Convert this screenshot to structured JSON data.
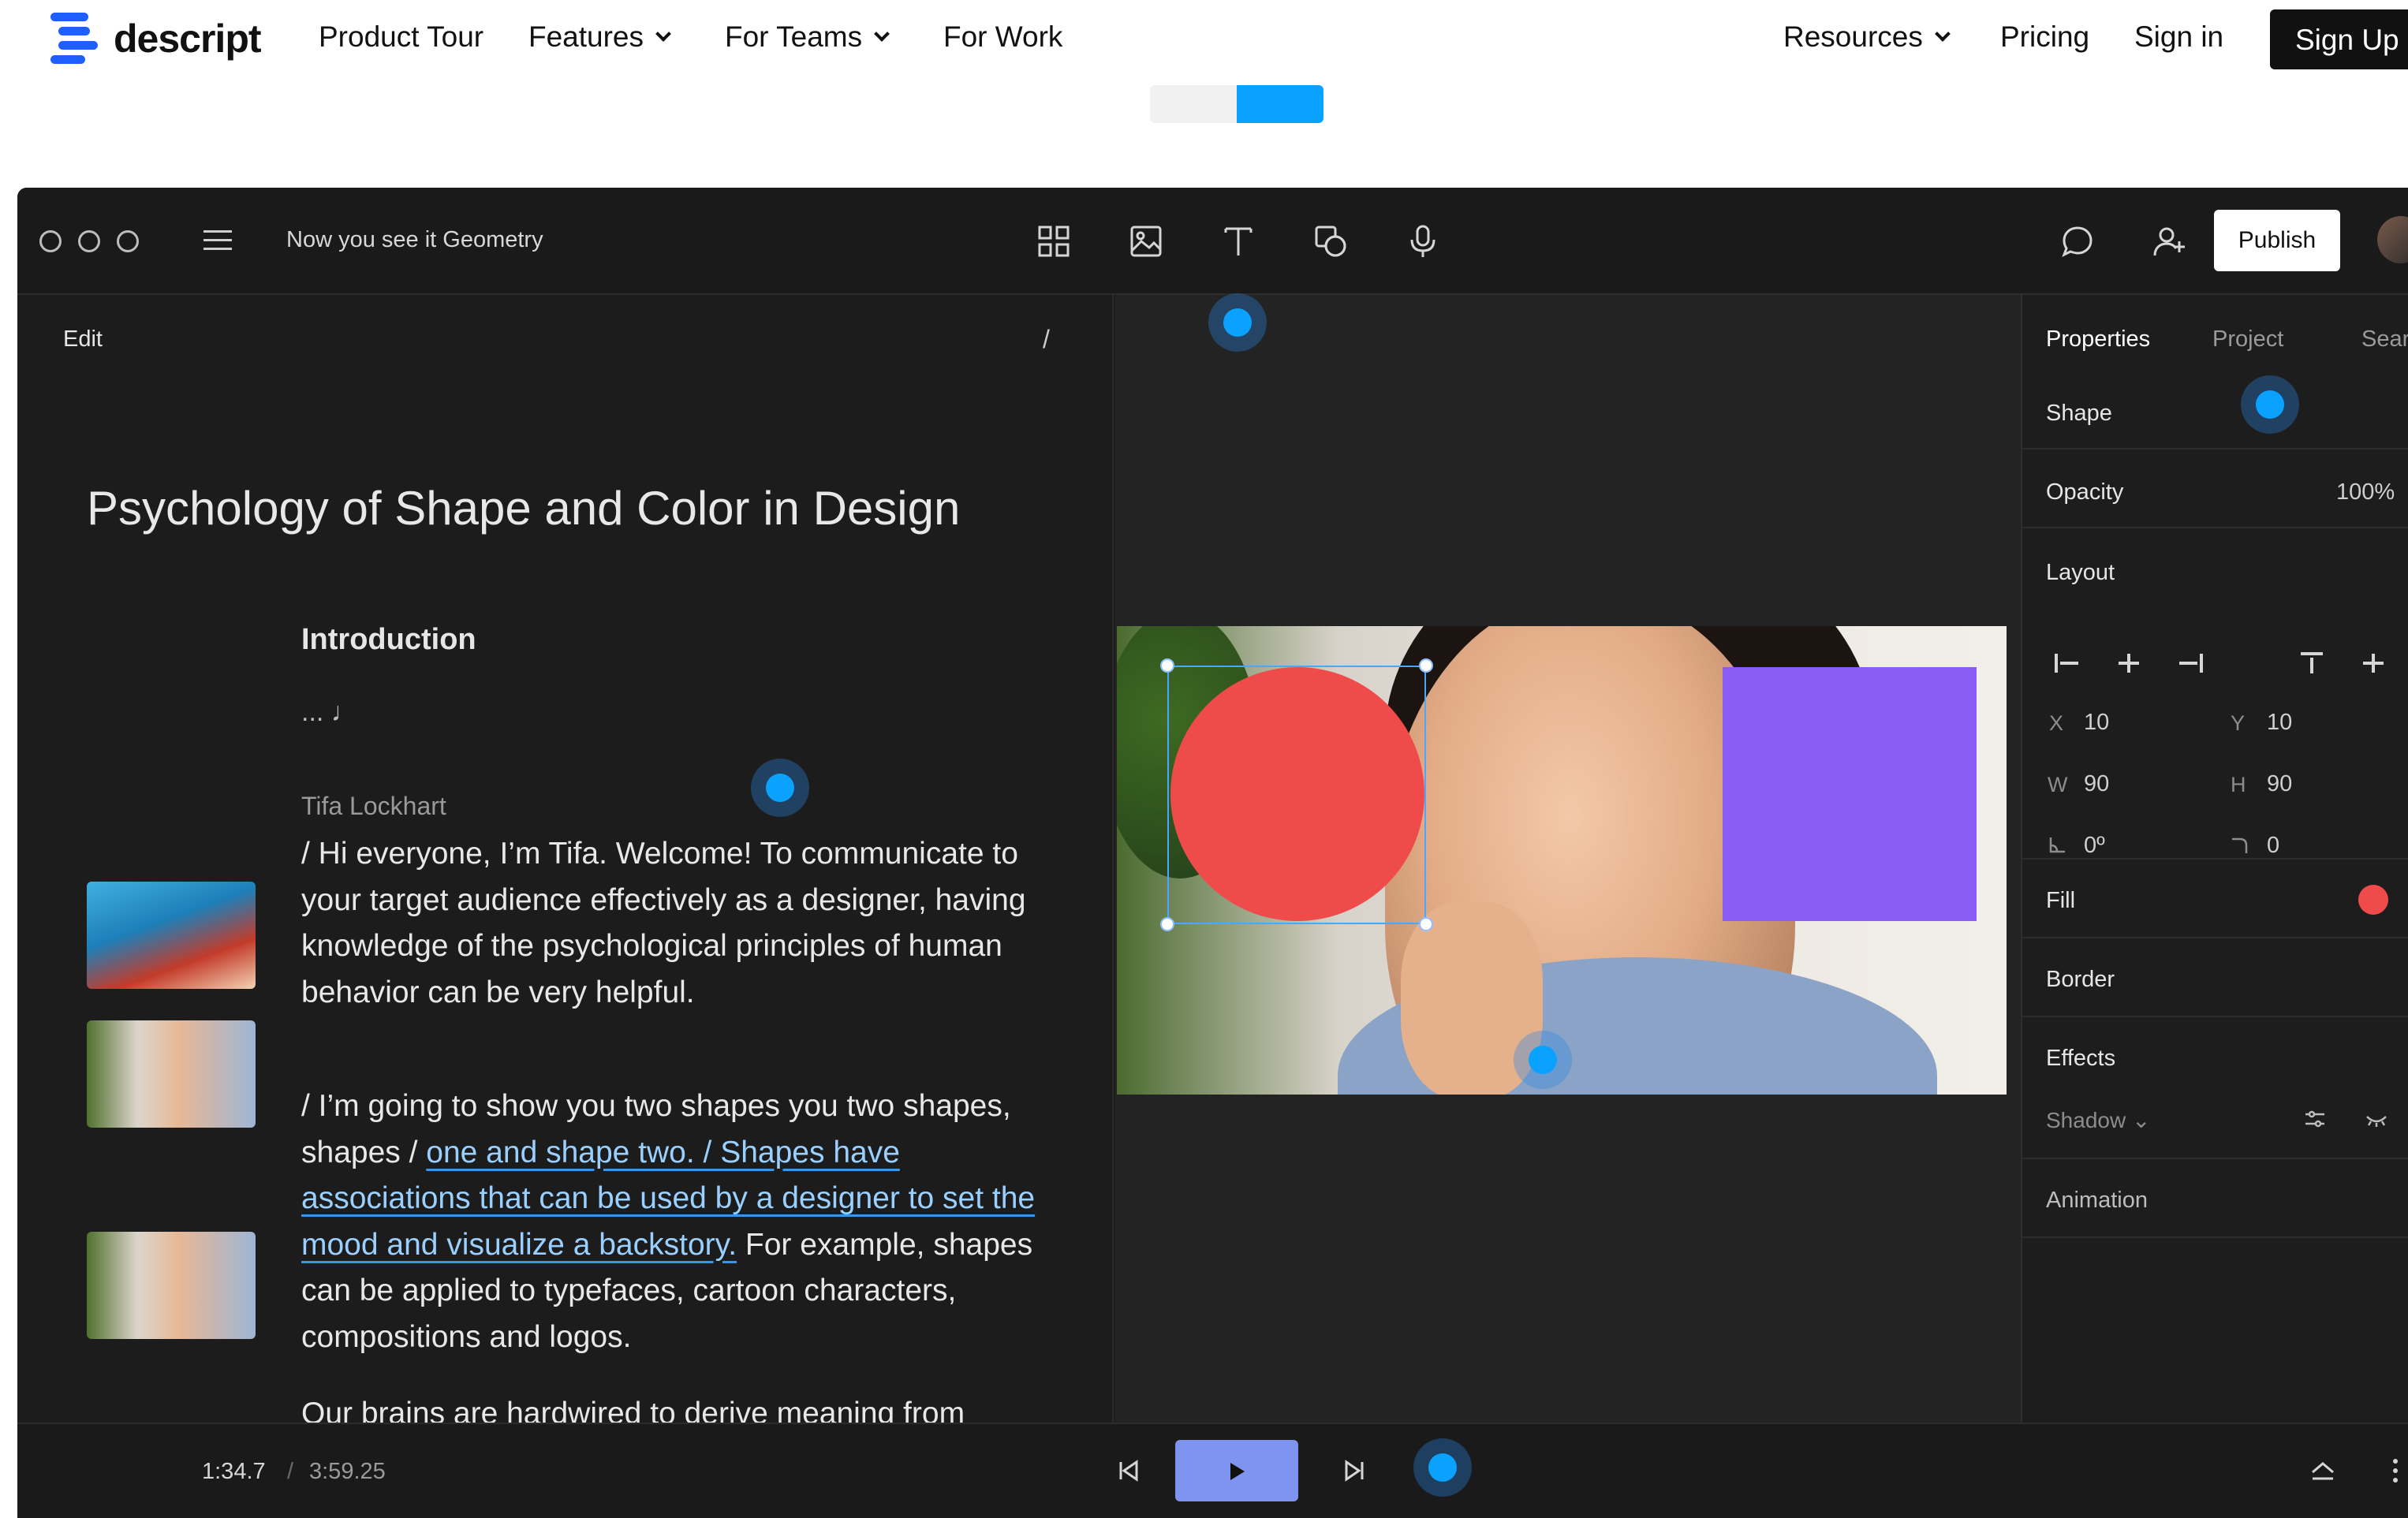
{
  "nav": {
    "brand": "descript",
    "links": [
      "Product Tour",
      "Features",
      "For Teams",
      "For Work"
    ],
    "right_links": [
      "Resources",
      "Pricing",
      "Sign in"
    ],
    "signup": "Sign Up"
  },
  "app": {
    "doc_title": "Now you see it Geometry",
    "publish": "Publish"
  },
  "script": {
    "edit_label": "Edit",
    "slash_label": "/",
    "title": "Psychology of Shape and Color in Design",
    "section": "Introduction",
    "music_marker": "... ♩",
    "speaker": "Tifa Lockhart",
    "para1": "/ Hi everyone, I’m Tifa. Welcome! To communicate to your target audience effectively as a designer, having knowledge of the psychological principles of human behavior can be very helpful.",
    "para2_a": "/ I’m going to show you two shapes you two shapes, shapes / ",
    "para2_link": "one and shape two. / Shapes have associations that can be used by a designer to set the mood and visualize a backstory.",
    "para2_b": " For example, shapes can be applied to typefaces, cartoon characters, compositions and logos.",
    "para3": "Our brains are hardwired to derive meaning from shapes, which have a bigger impact on our"
  },
  "panel": {
    "tabs": [
      "Properties",
      "Project",
      "Searc"
    ],
    "shape": "Shape",
    "opacity_label": "Opacity",
    "opacity_value": "100%",
    "layout": "Layout",
    "x_label": "X",
    "x_value": "10",
    "y_label": "Y",
    "y_value": "10",
    "w_label": "W",
    "w_value": "90",
    "h_label": "H",
    "h_value": "90",
    "rotation_value": "0º",
    "radius_value": "0",
    "fill": "Fill",
    "fill_color": "#f04b4b",
    "border": "Border",
    "effects": "Effects",
    "shadow": "Shadow",
    "animation": "Animation"
  },
  "transport": {
    "current_time": "1:34.7",
    "separator": "/",
    "total_time": "3:59.25"
  },
  "colors": {
    "accent": "#0aa1ff",
    "shape_red": "#f04b4b",
    "shape_purple": "#8a5cf6",
    "play": "#7f93f0"
  }
}
